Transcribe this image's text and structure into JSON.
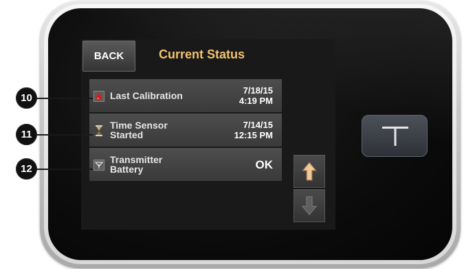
{
  "header": {
    "back_label": "BACK",
    "title": "Current Status"
  },
  "rows": [
    {
      "icon": "blood-drop-icon",
      "label": "Last Calibration",
      "value_line1": "7/18/15",
      "value_line2": "4:19 PM"
    },
    {
      "icon": "hourglass-icon",
      "label": "Time Sensor\nStarted",
      "value_line1": "7/14/15",
      "value_line2": "12:15 PM"
    },
    {
      "icon": "transmitter-antenna-icon",
      "label": "Transmitter\nBattery",
      "value_line1": "OK",
      "value_line2": ""
    }
  ],
  "callouts": [
    "10",
    "11",
    "12"
  ],
  "colors": {
    "title": "#f2c46d",
    "up_arrow": "#f0c89a",
    "down_arrow": "#6a6a6a",
    "screen_bg": "#191919",
    "row_bg": "#434343"
  }
}
